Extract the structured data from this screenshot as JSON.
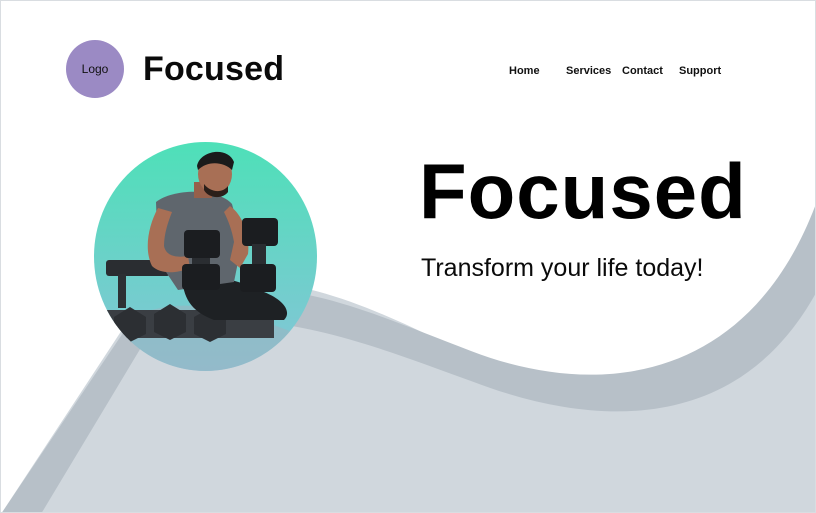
{
  "header": {
    "logo_label": "Logo",
    "brand": "Focused"
  },
  "nav": {
    "items": [
      {
        "label": "Home"
      },
      {
        "label": "Services"
      },
      {
        "label": "Contact"
      },
      {
        "label": "Support"
      }
    ]
  },
  "hero": {
    "title": "Focused",
    "subtitle": "Transform your life today!",
    "image_alt": "man lifting dumbbells"
  },
  "colors": {
    "logo_bg": "#9b8ac4",
    "wave_light": "#d0d7dd",
    "wave_dark": "#b7c0c8",
    "gradient_top": "#4ee0b8",
    "gradient_bottom": "#86c4d8"
  }
}
